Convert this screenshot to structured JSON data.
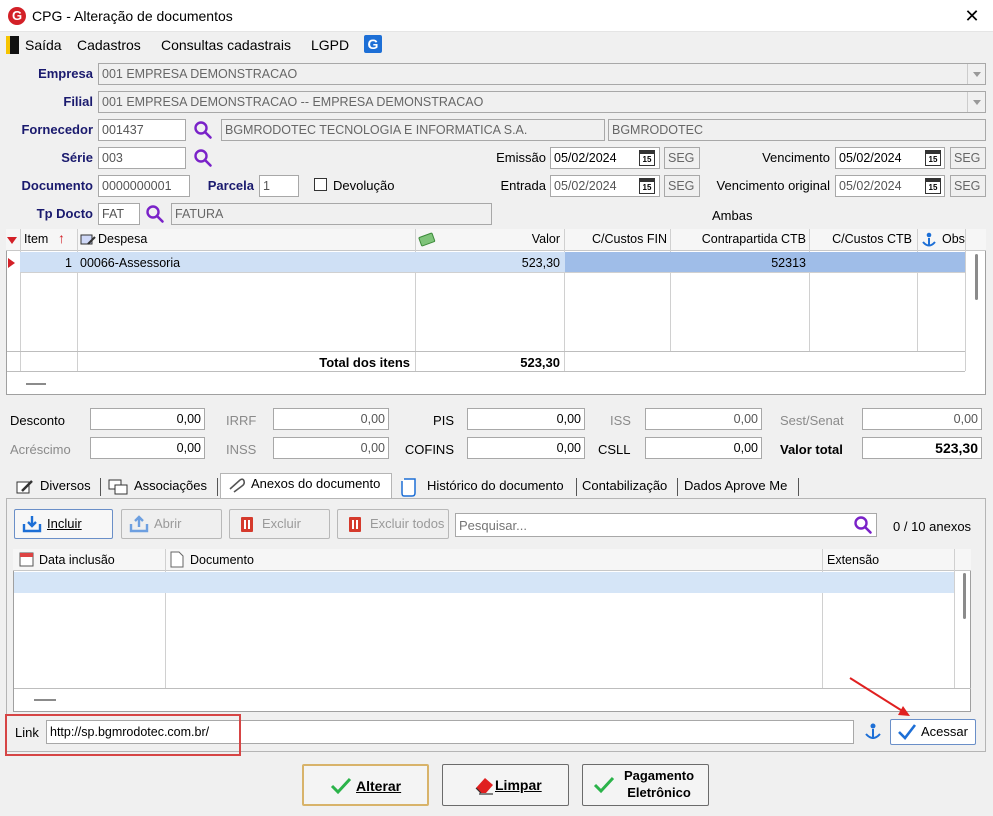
{
  "window": {
    "title": "CPG - Alteração de documentos",
    "close": "✕",
    "logo": "G"
  },
  "menu": [
    "Saída",
    "Cadastros",
    "Consultas cadastrais",
    "LGPD"
  ],
  "menu_underline": [
    "S",
    "C",
    "C",
    "L"
  ],
  "form": {
    "empresa_label": "Empresa",
    "empresa": "001 EMPRESA DEMONSTRACAO",
    "filial_label": "Filial",
    "filial": "001 EMPRESA DEMONSTRACAO -- EMPRESA DEMONSTRACAO",
    "fornecedor_label": "Fornecedor",
    "fornecedor_code": "001437",
    "fornecedor_name": "BGMRODOTEC TECNOLOGIA E INFORMATICA S.A.",
    "fornecedor_short": "BGMRODOTEC",
    "serie_label": "Série",
    "serie": "003",
    "documento_label": "Documento",
    "documento": "0000000001",
    "parcela_label": "Parcela",
    "parcela": "1",
    "devolucao_label": "Devolução",
    "tpdocto_label": "Tp Docto",
    "tpdocto_code": "FAT",
    "tpdocto_name": "FATURA",
    "emissao_label": "Emissão",
    "emissao": "05/02/2024",
    "emissao_day": "SEG",
    "entrada_label": "Entrada",
    "entrada": "05/02/2024",
    "entrada_day": "SEG",
    "vencimento_label": "Vencimento",
    "vencimento": "05/02/2024",
    "vencimento_day": "SEG",
    "vencimento_original_label": "Vencimento original",
    "vencimento_original": "05/02/2024",
    "vencimento_original_day": "SEG",
    "ambas": "Ambas",
    "cal_glyph": "15"
  },
  "items_grid": {
    "headers": [
      "Item",
      "Despesa",
      "Valor",
      "C/Custos FIN",
      "Contrapartida CTB",
      "C/Custos CTB",
      "Obs"
    ],
    "row": {
      "item": "1",
      "despesa": "00066-Assessoria",
      "valor": "523,30",
      "contrapartida": "52313"
    },
    "total_label": "Total dos itens",
    "total_value": "523,30"
  },
  "totals": {
    "desconto_label": "Desconto",
    "desconto": "0,00",
    "acrescimo_label": "Acréscimo",
    "acrescimo": "0,00",
    "irrf_label": "IRRF",
    "irrf": "0,00",
    "inss_label": "INSS",
    "inss": "0,00",
    "pis_label": "PIS",
    "pis": "0,00",
    "cofins_label": "COFINS",
    "cofins": "0,00",
    "iss_label": "ISS",
    "iss": "0,00",
    "csll_label": "CSLL",
    "csll": "0,00",
    "sest_label": "Sest/Senat",
    "sest": "0,00",
    "valor_total_label": "Valor total",
    "valor_total": "523,30"
  },
  "tabs": [
    "Diversos",
    "Associações",
    "Anexos do documento",
    "Histórico do documento",
    "Contabilização",
    "Dados Aprove Me"
  ],
  "anexos": {
    "incluir": "Incluir",
    "abrir": "Abrir",
    "excluir": "Excluir",
    "excluir_todos": "Excluir todos",
    "search_placeholder": "Pesquisar...",
    "count": "0 / 10 anexos",
    "headers": [
      "Data inclusão",
      "Documento",
      "Extensão"
    ],
    "link_label": "Link",
    "link_value": "http://sp.bgmrodotec.com.br/",
    "acessar": "Acessar"
  },
  "buttons": {
    "alterar": "Alterar",
    "limpar": "Limpar",
    "pagamento_l1": "Pagamento",
    "pagamento_l2": "Eletrônico"
  },
  "colors": {
    "accent_red": "#d32027",
    "purple_icon": "#7a22c8",
    "selection_blue": "#9fbde8"
  }
}
